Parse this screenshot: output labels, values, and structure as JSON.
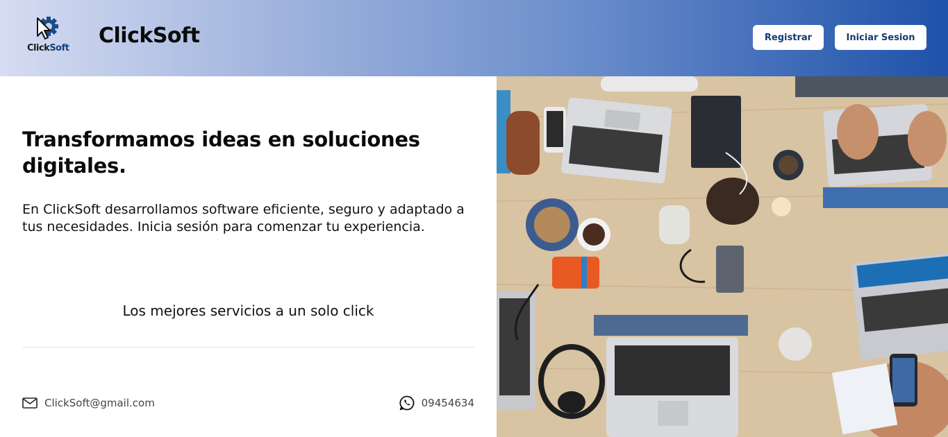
{
  "brand": {
    "logo_text_a": "Click",
    "logo_text_b": "Soft",
    "name": "ClickSoft"
  },
  "nav": {
    "register_label": "Registrar",
    "login_label": "Iniciar Sesion"
  },
  "hero": {
    "title": "Transformamos ideas en soluciones digitales.",
    "description": "En ClickSoft desarrollamos software eficiente, seguro y adaptado a tus necesidades. Inicia sesión para comenzar tu experiencia.",
    "tagline": "Los mejores servicios a un solo click"
  },
  "contact": {
    "email": "ClickSoft@gmail.com",
    "email_icon": "mail-icon",
    "phone": "09454634",
    "phone_icon": "whatsapp-icon"
  },
  "colors": {
    "header_gradient_start": "#d6dcf2",
    "header_gradient_end": "#1f52aa",
    "button_text": "#143a6e"
  }
}
